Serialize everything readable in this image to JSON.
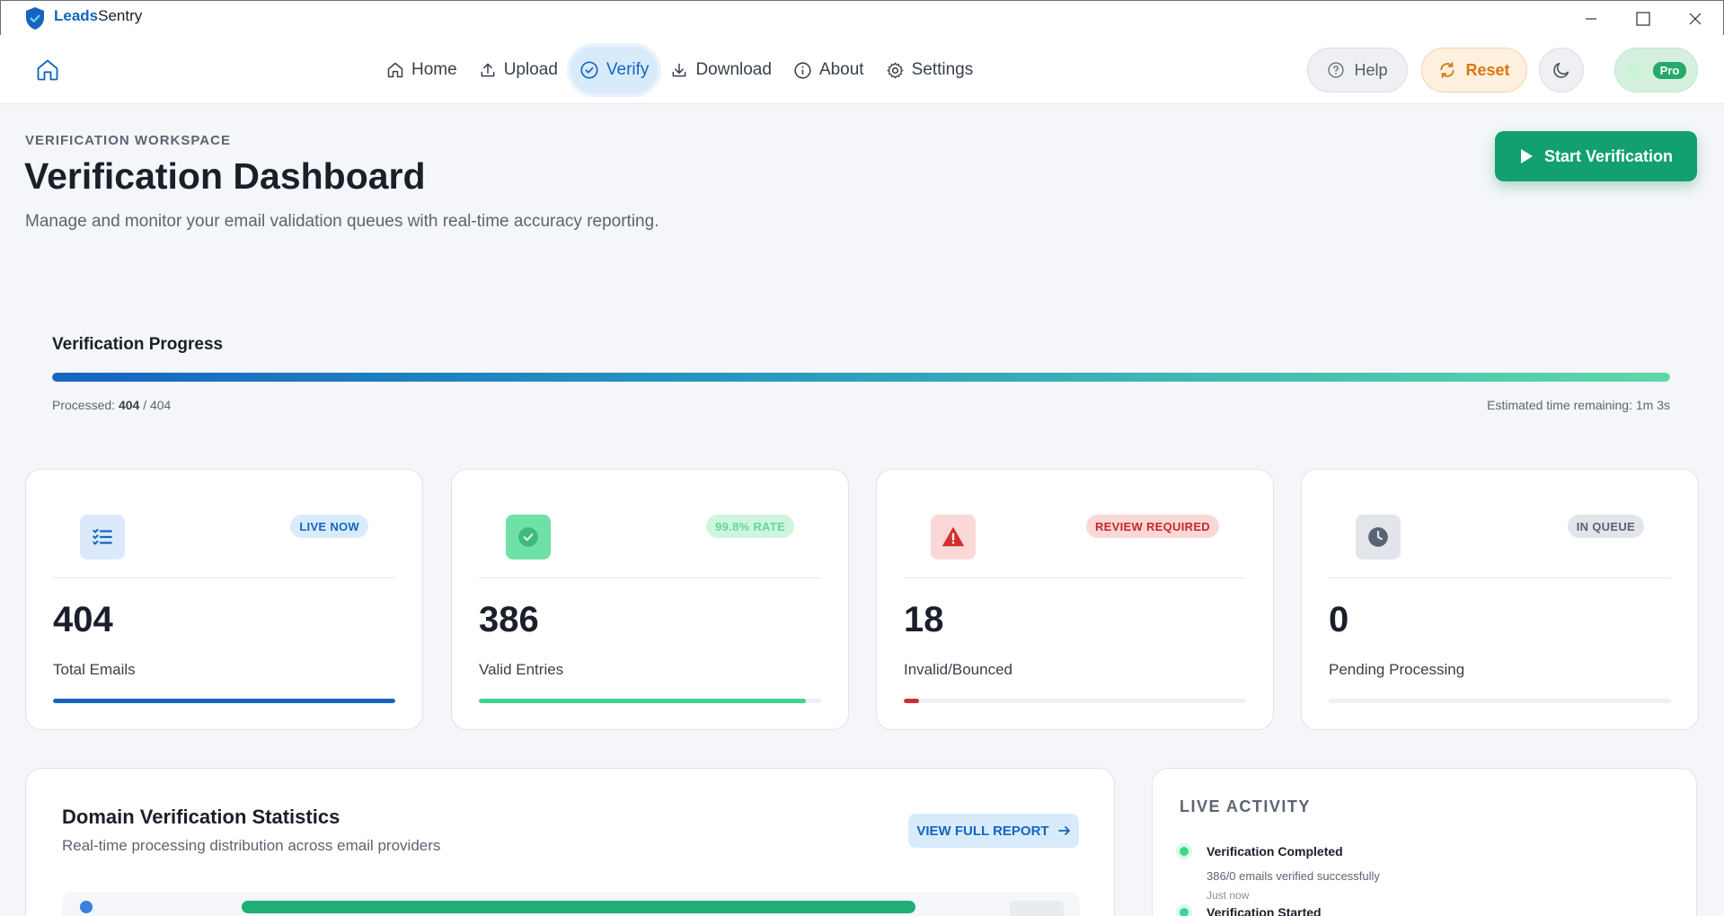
{
  "window": {
    "app_name_part1": "Leads",
    "app_name_part2": "Sentry"
  },
  "nav": {
    "items": [
      {
        "label": "Home",
        "icon": "home-icon"
      },
      {
        "label": "Upload",
        "icon": "upload-icon"
      },
      {
        "label": "Verify",
        "icon": "check-circle-icon",
        "active": true
      },
      {
        "label": "Download",
        "icon": "download-icon"
      },
      {
        "label": "About",
        "icon": "info-icon"
      },
      {
        "label": "Settings",
        "icon": "gear-icon"
      }
    ],
    "help_label": "Help",
    "reset_label": "Reset",
    "pro_label": "Pro"
  },
  "header": {
    "eyebrow": "VERIFICATION WORKSPACE",
    "title": "Verification Dashboard",
    "subtitle": "Manage and monitor your email validation queues with real-time accuracy reporting.",
    "start_button": "Start Verification"
  },
  "progress": {
    "title": "Verification Progress",
    "processed_label": "Processed:",
    "processed": "404",
    "separator": "/",
    "total": "404",
    "fraction": 1.0,
    "eta": "Estimated time remaining: 1m 3s"
  },
  "stats": [
    {
      "value": "404",
      "label": "Total Emails",
      "badge": "LIVE NOW",
      "icon": "list-checks-icon",
      "bar_fraction": 1.0,
      "color": "#1565c0"
    },
    {
      "value": "386",
      "label": "Valid Entries",
      "badge": "99.8% RATE",
      "icon": "check-circle-icon",
      "bar_fraction": 0.955,
      "color": "#3dd68c"
    },
    {
      "value": "18",
      "label": "Invalid/Bounced",
      "badge": "REVIEW REQUIRED",
      "icon": "warning-icon",
      "bar_fraction": 0.045,
      "color": "#d32f2f"
    },
    {
      "value": "0",
      "label": "Pending Processing",
      "badge": "IN QUEUE",
      "icon": "clock-icon",
      "bar_fraction": 0,
      "color": "#5a6375"
    }
  ],
  "domain": {
    "title": "Domain Verification Statistics",
    "subtitle": "Real-time processing distribution across email providers",
    "report_button": "VIEW FULL REPORT"
  },
  "activity": {
    "title": "LIVE ACTIVITY",
    "items": [
      {
        "heading": "Verification Completed",
        "detail": "386/0 emails verified successfully",
        "time": "Just now"
      },
      {
        "heading": "Verification Started"
      }
    ]
  }
}
